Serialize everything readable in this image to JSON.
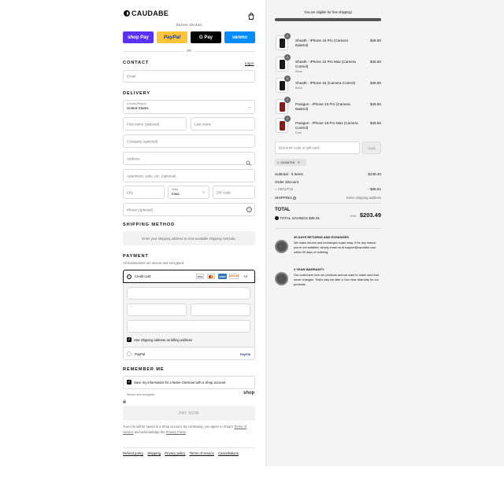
{
  "brand": {
    "name": "CAUDABE"
  },
  "express": {
    "label": "Express checkout",
    "buttons": [
      "shop Pay",
      "PayPal",
      "G Pay",
      "venmo"
    ],
    "or": "OR"
  },
  "contact": {
    "heading": "CONTACT",
    "login": "Log in",
    "email_placeholder": "Email"
  },
  "delivery": {
    "heading": "DELIVERY",
    "country_label": "Country/Region",
    "country_value": "United States",
    "first_name": "First name (optional)",
    "last_name": "Last name",
    "company": "Company (optional)",
    "address": "Address",
    "apartment": "Apartment, suite, etc. (optional)",
    "city": "City",
    "state_label": "State",
    "state_value": "Iowa",
    "zip": "ZIP code",
    "phone": "Phone (optional)"
  },
  "shipping_method": {
    "heading": "SHIPPING METHOD",
    "note": "Enter your shipping address to view available shipping methods."
  },
  "payment": {
    "heading": "PAYMENT",
    "secure": "All transactions are secure and encrypted.",
    "credit_card": "Credit card",
    "card_brands": [
      "VISA",
      "MC",
      "AMEX",
      "DISCOVER"
    ],
    "more": "+3",
    "billing_same": "Use shipping address as billing address",
    "paypal": "PayPal",
    "paypal_logo": "PayPal"
  },
  "remember": {
    "heading": "REMEMBER ME",
    "save_info": "Save my information for a faster checkout with a Shop account",
    "secure_note": "Secure and encrypted",
    "shop_logo": "shop"
  },
  "pay_now": "PAY NOW",
  "legal": {
    "pre": "Your info will be saved to a Shop account. By continuing, you agree to Shop's ",
    "terms": "Terms of Service",
    "mid": " and acknowledge the ",
    "privacy": "Privacy Policy",
    "post": "."
  },
  "footer_links": [
    "Refund policy",
    "Shipping",
    "Privacy policy",
    "Terms of service",
    "Cancellations"
  ],
  "summary": {
    "free_shipping": "You are eligible for free shipping!",
    "free_shipping_progress": 1.0,
    "items": [
      {
        "name": "Sheath - iPhone 16 Pro (Camera Control)",
        "variant": "Black",
        "price": "$46.80",
        "qty": "1",
        "color": "#1a1a1a"
      },
      {
        "name": "Sheath - iPhone 16 Pro Max (Camera Control)",
        "variant": "Black",
        "price": "$46.80",
        "qty": "1",
        "color": "#1a1a1a"
      },
      {
        "name": "Sheath - iPhone 16 (Camera Control)",
        "variant": "Black",
        "price": "$46.80",
        "qty": "1",
        "color": "#1a1a1a"
      },
      {
        "name": "Paragon - iPhone 16 Pro (Camera Control)",
        "variant": "Rubi",
        "price": "$49.50",
        "qty": "1",
        "color": "#8b1a1a"
      },
      {
        "name": "Paragon - iPhone 16 Pro Max (Camera Control)",
        "variant": "Rubi",
        "price": "$49.50",
        "qty": "1",
        "color": "#8b1a1a"
      }
    ],
    "discount_placeholder": "Discount code or gift card",
    "apply": "Apply",
    "code_tag": "CKOUT15",
    "subtotal_label": "Subtotal · 5 items",
    "subtotal_value": "$239.40",
    "order_discount_label": "Order discount",
    "discount_code": "CKOUT15",
    "discount_value": "- $35.91",
    "shipping_label": "SHIPPING",
    "shipping_value": "Enter shipping address",
    "total_label": "TOTAL",
    "currency": "USD",
    "total_value": "$203.49",
    "savings_label": "TOTAL SAVINGS",
    "savings_value": "$35.91",
    "returns_title": "30 DAYS RETURNS AND EXHANGES",
    "returns_text": "We make returns and exchanges super easy. If for any reason you're not satisfied, simply email us at support@caudabe.com within 30 days of ordering.",
    "warranty_title": "2 YEAR WARRANTY",
    "warranty_text": "Our customers love our products and we want to make sure that never changes. That's why we offer a Two-Year Warranty for our products."
  },
  "colors": {
    "shop_pay": "#5a31f4",
    "paypal": "#ffc439",
    "gpay": "#000000",
    "venmo": "#008cff"
  }
}
